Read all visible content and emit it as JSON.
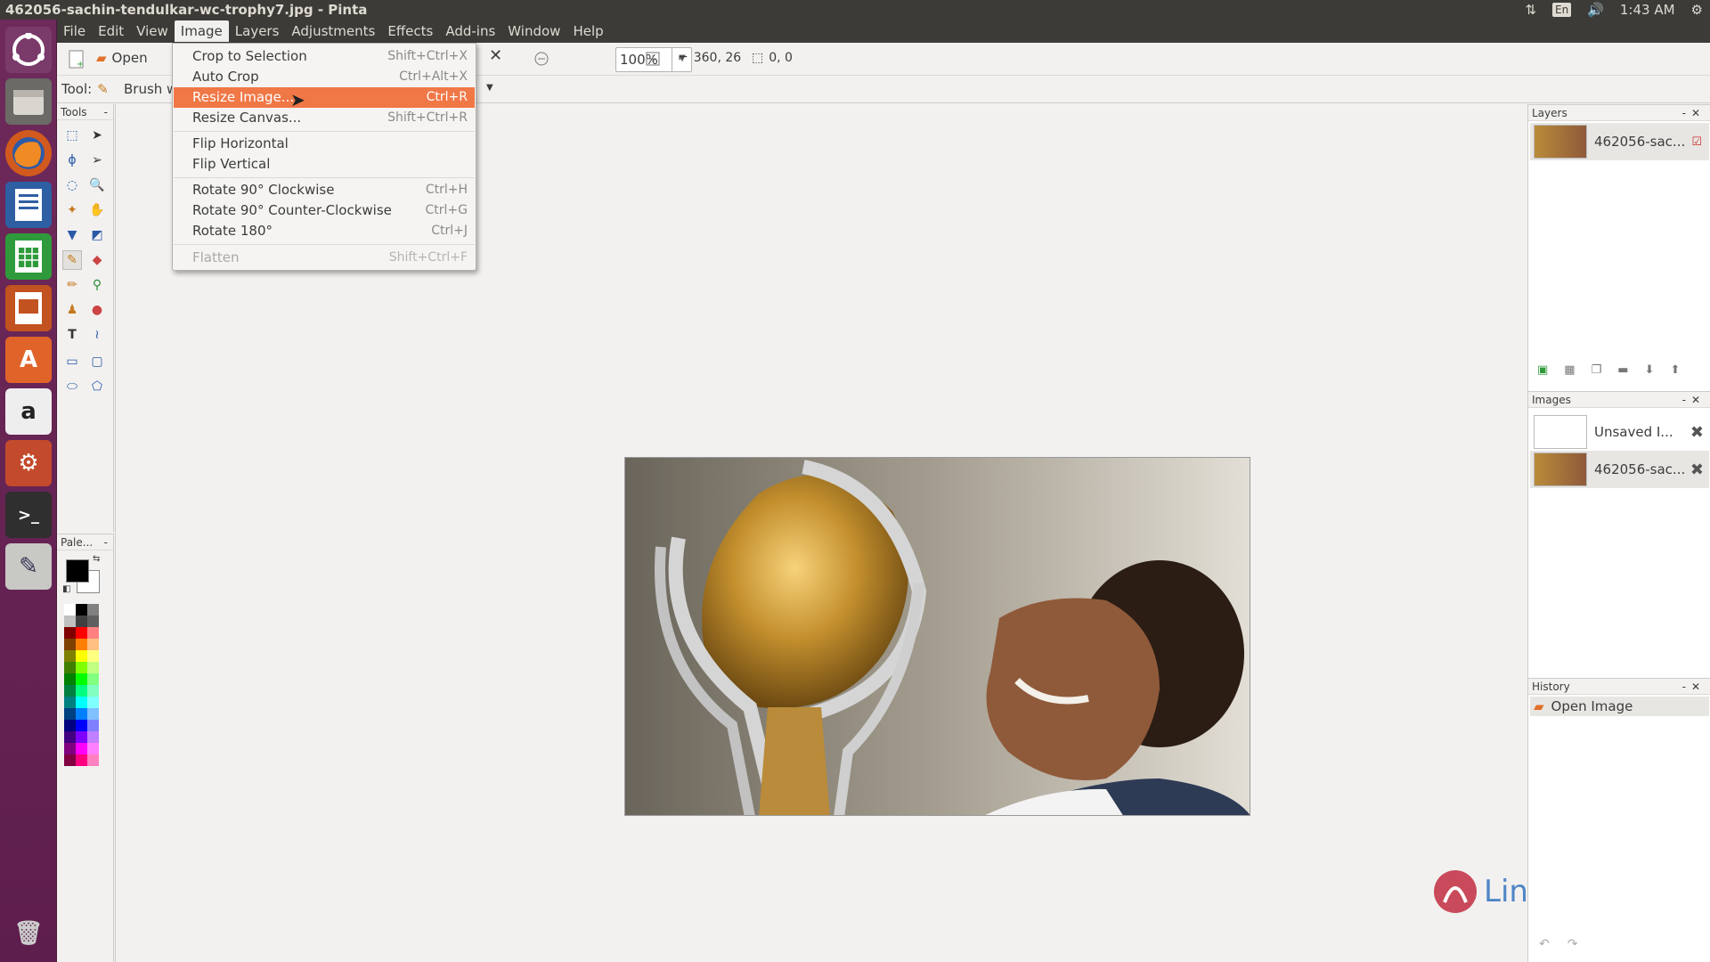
{
  "window": {
    "title": "462056-sachin-tendulkar-wc-trophy7.jpg - Pinta",
    "clock": "1:43 AM",
    "keyboard": "En"
  },
  "menubar": [
    "File",
    "Edit",
    "View",
    "Image",
    "Layers",
    "Adjustments",
    "Effects",
    "Add-ins",
    "Window",
    "Help"
  ],
  "toolbar": {
    "open_label": "Open",
    "zoom_value": "100%",
    "cursor_position": "360, 26",
    "selection_size": "0, 0",
    "tool_label": "Tool:",
    "brush_label": "Brush w"
  },
  "image_menu": {
    "items": [
      {
        "label": "Crop to Selection",
        "shortcut": "Shift+Ctrl+X"
      },
      {
        "label": "Auto Crop",
        "shortcut": "Ctrl+Alt+X"
      },
      {
        "label": "Resize Image...",
        "shortcut": "Ctrl+R"
      },
      {
        "label": "Resize Canvas...",
        "shortcut": "Shift+Ctrl+R"
      },
      {
        "label": "Flip Horizontal",
        "shortcut": ""
      },
      {
        "label": "Flip Vertical",
        "shortcut": ""
      },
      {
        "label": "Rotate 90° Clockwise",
        "shortcut": "Ctrl+H"
      },
      {
        "label": "Rotate 90° Counter-Clockwise",
        "shortcut": "Ctrl+G"
      },
      {
        "label": "Rotate 180°",
        "shortcut": "Ctrl+J"
      },
      {
        "label": "Flatten",
        "shortcut": "Shift+Ctrl+F"
      }
    ]
  },
  "panels": {
    "tools_title": "Tools",
    "palette_title": "Pale...",
    "layers_title": "Layers",
    "images_title": "Images",
    "history_title": "History"
  },
  "layers": [
    {
      "name": "462056-sac..."
    }
  ],
  "images": [
    {
      "name": "Unsaved I..."
    },
    {
      "name": "462056-sac..."
    }
  ],
  "history": [
    {
      "name": "Open Image"
    }
  ],
  "watermark": "LinuxHelp",
  "colors": {
    "accent": "#f07746",
    "launcher": "#6e2a5a",
    "topbar": "#3c3b37"
  }
}
